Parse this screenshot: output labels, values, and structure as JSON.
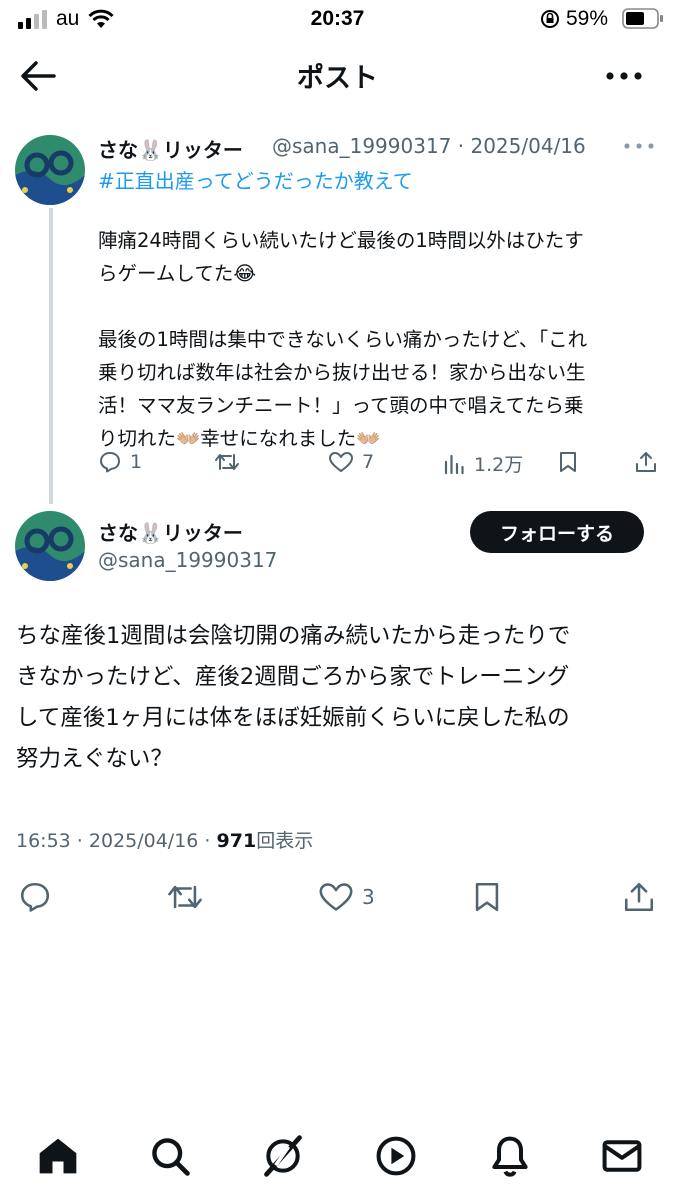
{
  "status_bar": {
    "carrier": "au",
    "time": "20:37",
    "battery": "59%"
  },
  "header": {
    "title": "ポスト"
  },
  "parent_post": {
    "display_name": "さな🐰リッター",
    "handle": "@sana_19990317",
    "sep": "·",
    "date": "2025/04/16",
    "hashtag": "#正直出産ってどうだったか教えて",
    "body": "陣痛24時間くらい続いたけど最後の1時間以外はひたす\nらゲームしてた😂\n\n最後の1時間は集中できないくらい痛かったけど、「これ\n乗り切れば数年は社会から抜け出せる！家から出ない生\n活！ママ友ランチニート！」って頭の中で唱えてたら乗\nり切れた👐🏼幸せになれました👐🏼",
    "replies": "1",
    "likes": "7",
    "views": "1.2万"
  },
  "main_post": {
    "display_name": "さな🐰リッター",
    "handle": "@sana_19990317",
    "follow_label": "フォローする",
    "body": "ちな産後1週間は会陰切開の痛み続いたから走ったりで\nきなかったけど、産後2週間ごろから家でトレーニング\nして産後1ヶ月には体をほぼ妊娠前くらいに戻した私の\n努力えぐない？",
    "timestamp": "16:53 · 2025/04/16 ·",
    "view_count": "971",
    "view_suffix": "回表示",
    "likes": "3"
  },
  "colors": {
    "accent": "#1d9bf0",
    "text": "#0f1419",
    "muted": "#536471",
    "thread_line": "#cfd9de"
  },
  "icons": [
    "back-arrow-icon",
    "more-icon",
    "reply-icon",
    "retweet-icon",
    "like-icon",
    "views-icon",
    "bookmark-icon",
    "share-icon",
    "home-icon",
    "search-icon",
    "grok-icon",
    "video-icon",
    "notifications-icon",
    "messages-icon"
  ]
}
